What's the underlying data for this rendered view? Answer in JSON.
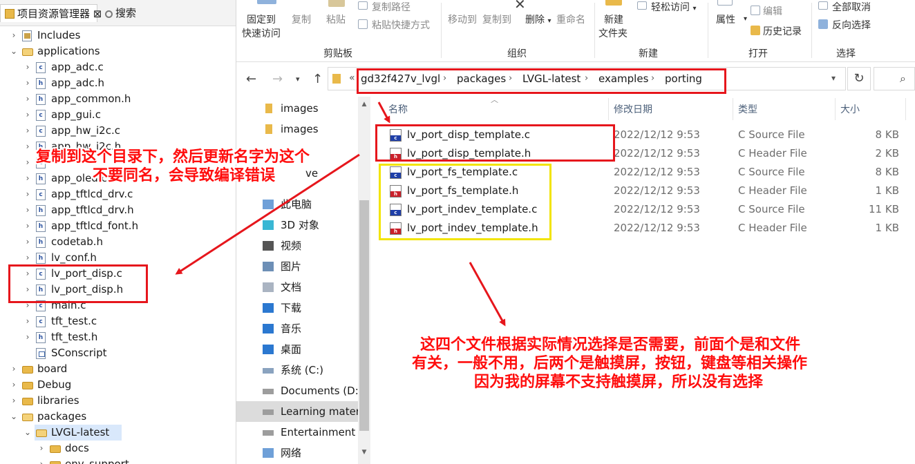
{
  "tabs": {
    "project": "项目资源管理器 ⊠",
    "search": "搜索"
  },
  "tree": [
    {
      "label": "Includes",
      "depth": 1,
      "expand": "right",
      "icon": "include"
    },
    {
      "label": "applications",
      "depth": 1,
      "expand": "down",
      "icon": "folder-open"
    },
    {
      "label": "app_adc.c",
      "depth": 2,
      "expand": "right",
      "icon": "c-file"
    },
    {
      "label": "app_adc.h",
      "depth": 2,
      "expand": "right",
      "icon": "h-file"
    },
    {
      "label": "app_common.h",
      "depth": 2,
      "expand": "right",
      "icon": "h-file"
    },
    {
      "label": "app_gui.c",
      "depth": 2,
      "expand": "right",
      "icon": "c-file"
    },
    {
      "label": "app_hw_i2c.c",
      "depth": 2,
      "expand": "right",
      "icon": "c-file"
    },
    {
      "label": "app_hw_i2c.h",
      "depth": 2,
      "expand": "right",
      "icon": "h-file"
    },
    {
      "label": "",
      "depth": 2,
      "expand": "right",
      "icon": "c-file"
    },
    {
      "label": "app_oled.c",
      "depth": 2,
      "expand": "right",
      "icon": "h-file"
    },
    {
      "label": "app_tftlcd_drv.c",
      "depth": 2,
      "expand": "right",
      "icon": "c-file"
    },
    {
      "label": "app_tftlcd_drv.h",
      "depth": 2,
      "expand": "right",
      "icon": "h-file"
    },
    {
      "label": "app_tftlcd_font.h",
      "depth": 2,
      "expand": "right",
      "icon": "h-file"
    },
    {
      "label": "codetab.h",
      "depth": 2,
      "expand": "right",
      "icon": "h-file"
    },
    {
      "label": "lv_conf.h",
      "depth": 2,
      "expand": "right",
      "icon": "h-file"
    },
    {
      "label": "lv_port_disp.c",
      "depth": 2,
      "expand": "right",
      "icon": "c-file"
    },
    {
      "label": "lv_port_disp.h",
      "depth": 2,
      "expand": "right",
      "icon": "h-file"
    },
    {
      "label": "main.c",
      "depth": 2,
      "expand": "right",
      "icon": "c-file"
    },
    {
      "label": "tft_test.c",
      "depth": 2,
      "expand": "right",
      "icon": "c-file"
    },
    {
      "label": "tft_test.h",
      "depth": 2,
      "expand": "right",
      "icon": "h-file"
    },
    {
      "label": "SConscript",
      "depth": 2,
      "expand": "none",
      "icon": "file"
    },
    {
      "label": "board",
      "depth": 1,
      "expand": "right",
      "icon": "folder"
    },
    {
      "label": "Debug",
      "depth": 1,
      "expand": "right",
      "icon": "folder"
    },
    {
      "label": "libraries",
      "depth": 1,
      "expand": "right",
      "icon": "folder"
    },
    {
      "label": "packages",
      "depth": 1,
      "expand": "down",
      "icon": "folder-open"
    },
    {
      "label": "LVGL-latest",
      "depth": 2,
      "expand": "down",
      "icon": "folder-open",
      "selected": true
    },
    {
      "label": "docs",
      "depth": 3,
      "expand": "right",
      "icon": "folder"
    },
    {
      "label": "env_support",
      "depth": 3,
      "expand": "right",
      "icon": "folder"
    }
  ],
  "ribbon": {
    "pin": "固定到",
    "pin2": "快速访问",
    "copy": "复制",
    "paste": "粘贴",
    "copy_path": "复制路径",
    "paste_shortcut": "粘贴快捷方式",
    "move_to": "移动到",
    "copy_to": "复制到",
    "delete": "删除",
    "rename": "重命名",
    "new": "新建",
    "new_folder": "文件夹",
    "easy_access": "轻松访问",
    "properties": "属性",
    "edit": "编辑",
    "history": "历史记录",
    "select_none": "全部取消",
    "invert": "反向选择",
    "groups": {
      "clipboard": "剪贴板",
      "organize": "组织",
      "new": "新建",
      "open": "打开",
      "select": "选择"
    }
  },
  "breadcrumb": [
    "gd32f427v_lvgl",
    "packages",
    "LVGL-latest",
    "examples",
    "porting"
  ],
  "breadcrumb_overflow": "«",
  "nav": [
    {
      "label": "images",
      "icon": "folder"
    },
    {
      "label": "images",
      "icon": "folder"
    },
    {
      "label": "",
      "icon": "folder"
    },
    {
      "label": "",
      "icon": "folder"
    },
    {
      "label": "",
      "icon": "folder"
    },
    {
      "label": "此电脑",
      "icon": "pc"
    },
    {
      "label": "3D 对象",
      "icon": "cube"
    },
    {
      "label": "视频",
      "icon": "video"
    },
    {
      "label": "图片",
      "icon": "picture"
    },
    {
      "label": "文档",
      "icon": "document"
    },
    {
      "label": "下载",
      "icon": "download"
    },
    {
      "label": "音乐",
      "icon": "music"
    },
    {
      "label": "桌面",
      "icon": "desktop"
    },
    {
      "label": "系统 (C:)",
      "icon": "drive-system"
    },
    {
      "label": "Documents (D:)",
      "icon": "drive"
    },
    {
      "label": "Learning mater",
      "icon": "drive",
      "selected": true
    },
    {
      "label": "Entertainment",
      "icon": "drive"
    },
    {
      "label": "网络",
      "icon": "network"
    }
  ],
  "nav_clip": "ve",
  "columns": {
    "name": "名称",
    "date": "修改日期",
    "type": "类型",
    "size": "大小"
  },
  "files": [
    {
      "name": "lv_port_disp_template.c",
      "date": "2022/12/12 9:53",
      "type": "C Source File",
      "size": "8 KB",
      "kind": "c"
    },
    {
      "name": "lv_port_disp_template.h",
      "date": "2022/12/12 9:53",
      "type": "C Header File",
      "size": "2 KB",
      "kind": "h"
    },
    {
      "name": "lv_port_fs_template.c",
      "date": "2022/12/12 9:53",
      "type": "C Source File",
      "size": "8 KB",
      "kind": "c"
    },
    {
      "name": "lv_port_fs_template.h",
      "date": "2022/12/12 9:53",
      "type": "C Header File",
      "size": "1 KB",
      "kind": "h"
    },
    {
      "name": "lv_port_indev_template.c",
      "date": "2022/12/12 9:53",
      "type": "C Source File",
      "size": "11 KB",
      "kind": "c"
    },
    {
      "name": "lv_port_indev_template.h",
      "date": "2022/12/12 9:53",
      "type": "C Header File",
      "size": "1 KB",
      "kind": "h"
    }
  ],
  "annotations": {
    "copy_note_1": "复制到这个目录下，然后更新名字为这个",
    "copy_note_2": "不要同名，会导致编译错误",
    "select_note_1": "这四个文件根据实际情况选择是否需要，前面个是和文件",
    "select_note_2": "有关，一般不用，后两个是触摸屏，按钮，键盘等相关操作",
    "select_note_3": "因为我的屏幕不支持触摸屏，所以没有选择"
  },
  "colors": {
    "annotation_red": "#e6161c",
    "annotation_yellow": "#f2e400",
    "selection": "#d9e8fb"
  }
}
